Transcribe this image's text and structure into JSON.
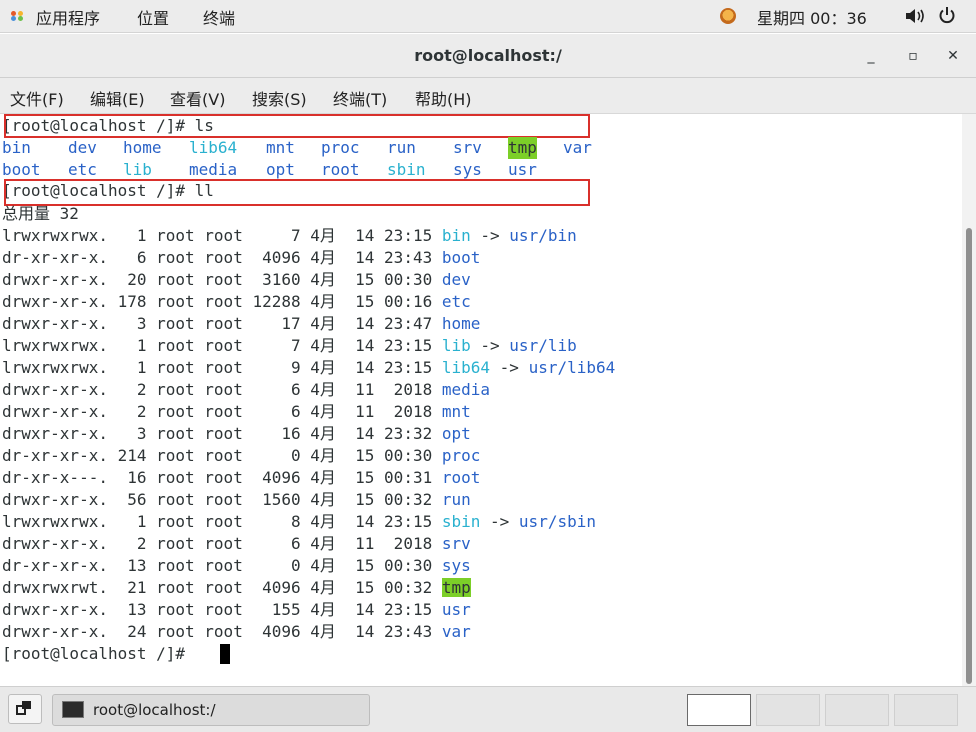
{
  "top_panel": {
    "apps_label": "应用程序",
    "places_label": "位置",
    "terminal_label": "终端",
    "clock": "星期四 00：36"
  },
  "window": {
    "title": "root@localhost:/",
    "minimize": "_",
    "maximize": "▫",
    "close": "✕"
  },
  "menu": [
    "文件(F)",
    "编辑(E)",
    "查看(V)",
    "搜索(S)",
    "终端(T)",
    "帮助(H)"
  ],
  "colors": {
    "dir": "#2a62c7",
    "symlink": "#2ab1cf",
    "tmp_bg": "#7ccf28",
    "highlight_box": "#d9302b"
  },
  "terminal": {
    "prompt1": "[root@localhost /]# ls",
    "ls_row1": [
      "bin",
      "dev",
      "home",
      "lib64",
      "mnt",
      "proc",
      "run",
      "srv",
      "tmp",
      "var"
    ],
    "ls_row2": [
      "boot",
      "etc",
      "lib",
      "media",
      "opt",
      "root",
      "sbin",
      "sys",
      "usr"
    ],
    "prompt2": "[root@localhost /]# ll",
    "total": "总用量 32",
    "entries": [
      {
        "meta": "lrwxrwxrwx.   1 root root     7 4月  14 23:15 ",
        "name": "bin",
        "kind": "link",
        "arrow": " -> ",
        "target": "usr/bin"
      },
      {
        "meta": "dr-xr-xr-x.   6 root root  4096 4月  14 23:43 ",
        "name": "boot",
        "kind": "dir"
      },
      {
        "meta": "drwxr-xr-x.  20 root root  3160 4月  15 00:30 ",
        "name": "dev",
        "kind": "dir"
      },
      {
        "meta": "drwxr-xr-x. 178 root root 12288 4月  15 00:16 ",
        "name": "etc",
        "kind": "dir"
      },
      {
        "meta": "drwxr-xr-x.   3 root root    17 4月  14 23:47 ",
        "name": "home",
        "kind": "dir"
      },
      {
        "meta": "lrwxrwxrwx.   1 root root     7 4月  14 23:15 ",
        "name": "lib",
        "kind": "link",
        "arrow": " -> ",
        "target": "usr/lib"
      },
      {
        "meta": "lrwxrwxrwx.   1 root root     9 4月  14 23:15 ",
        "name": "lib64",
        "kind": "link",
        "arrow": " -> ",
        "target": "usr/lib64"
      },
      {
        "meta": "drwxr-xr-x.   2 root root     6 4月  11  2018 ",
        "name": "media",
        "kind": "dir"
      },
      {
        "meta": "drwxr-xr-x.   2 root root     6 4月  11  2018 ",
        "name": "mnt",
        "kind": "dir"
      },
      {
        "meta": "drwxr-xr-x.   3 root root    16 4月  14 23:32 ",
        "name": "opt",
        "kind": "dir"
      },
      {
        "meta": "dr-xr-xr-x. 214 root root     0 4月  15 00:30 ",
        "name": "proc",
        "kind": "dir"
      },
      {
        "meta": "dr-xr-x---.  16 root root  4096 4月  15 00:31 ",
        "name": "root",
        "kind": "dir"
      },
      {
        "meta": "drwxr-xr-x.  56 root root  1560 4月  15 00:32 ",
        "name": "run",
        "kind": "dir"
      },
      {
        "meta": "lrwxrwxrwx.   1 root root     8 4月  14 23:15 ",
        "name": "sbin",
        "kind": "link",
        "arrow": " -> ",
        "target": "usr/sbin"
      },
      {
        "meta": "drwxr-xr-x.   2 root root     6 4月  11  2018 ",
        "name": "srv",
        "kind": "dir"
      },
      {
        "meta": "dr-xr-xr-x.  13 root root     0 4月  15 00:30 ",
        "name": "sys",
        "kind": "dir"
      },
      {
        "meta": "drwxrwxrwt.  21 root root  4096 4月  15 00:32 ",
        "name": "tmp",
        "kind": "tmp"
      },
      {
        "meta": "drwxr-xr-x.  13 root root   155 4月  14 23:15 ",
        "name": "usr",
        "kind": "dir"
      },
      {
        "meta": "drwxr-xr-x.  24 root root  4096 4月  14 23:43 ",
        "name": "var",
        "kind": "dir"
      }
    ],
    "prompt3": "[root@localhost /]# "
  },
  "taskbar": {
    "task_label": "root@localhost:/"
  }
}
